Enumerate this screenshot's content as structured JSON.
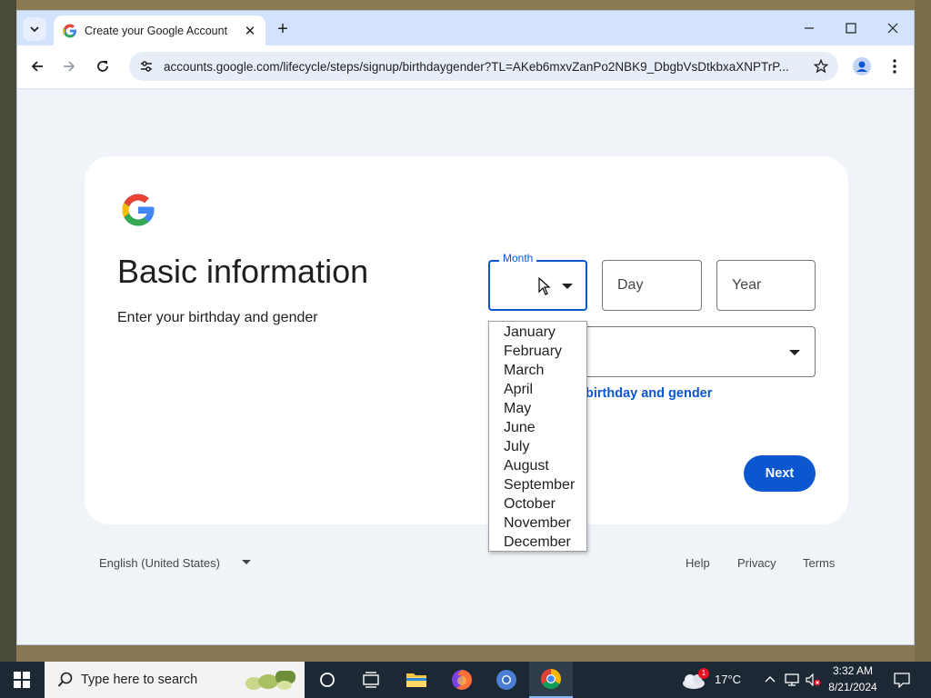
{
  "browser": {
    "tab_title": "Create your Google Account",
    "url": "accounts.google.com/lifecycle/steps/signup/birthdaygender?TL=AKeb6mxvZanPo2NBK9_DbgbVsDtkbxaXNPTrP..."
  },
  "page": {
    "heading": "Basic information",
    "subheading": "Enter your birthday and gender",
    "month_label": "Month",
    "day_placeholder": "Day",
    "year_placeholder": "Year",
    "link_partial": "birthday and gender",
    "next_label": "Next",
    "months": [
      "January",
      "February",
      "March",
      "April",
      "May",
      "June",
      "July",
      "August",
      "September",
      "October",
      "November",
      "December"
    ]
  },
  "footer": {
    "language": "English (United States)",
    "help": "Help",
    "privacy": "Privacy",
    "terms": "Terms"
  },
  "taskbar": {
    "search_placeholder": "Type here to search",
    "temperature": "17°C",
    "weather_badge": "1",
    "time": "3:32 AM",
    "date": "8/21/2024"
  },
  "colors": {
    "accent": "#0b57d0",
    "page_bg": "#f0f4f9",
    "taskbar_bg": "#1c2833"
  }
}
